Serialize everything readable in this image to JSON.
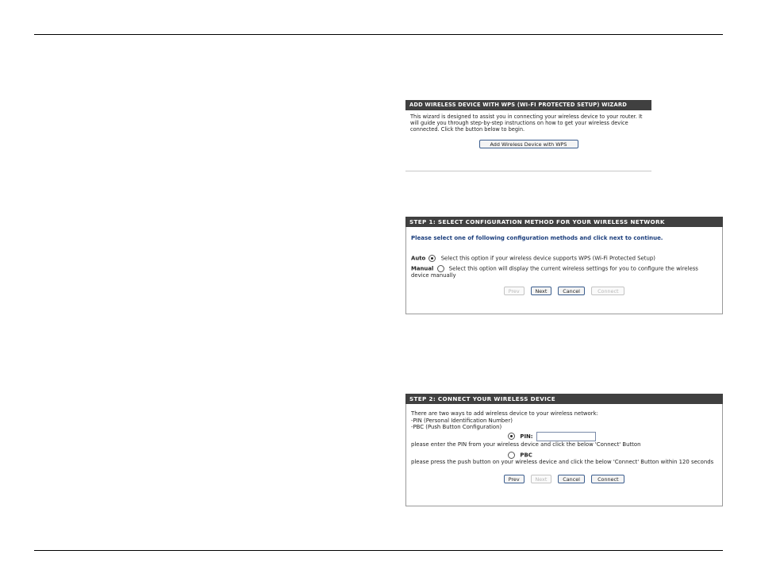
{
  "wizard_panel": {
    "title": "ADD WIRELESS DEVICE WITH WPS (WI-FI PROTECTED SETUP) WIZARD",
    "description": "This wizard is designed to assist you in connecting your wireless device to your router. It will guide you through step-by-step instructions on how to get your wireless device connected. Click the button below to begin.",
    "button_label": "Add Wireless Device with WPS"
  },
  "step1_panel": {
    "title": "STEP 1: SELECT CONFIGURATION METHOD FOR YOUR WIRELESS NETWORK",
    "instruction": "Please select one of following configuration methods and click next to continue.",
    "auto_label": "Auto",
    "auto_text": "Select this option if your wireless device supports WPS (Wi-Fi Protected Setup)",
    "auto_selected": true,
    "manual_label": "Manual",
    "manual_text": "Select this option will display the current wireless settings for you to configure the wireless device manually",
    "manual_selected": false,
    "buttons": {
      "prev": "Prev",
      "next": "Next",
      "cancel": "Cancel",
      "connect": "Connect"
    }
  },
  "step2_panel": {
    "title": "STEP 2: CONNECT YOUR WIRELESS DEVICE",
    "line1": "There are two ways to add wireless device to your wireless network:",
    "line2": "-PIN (Personal Identification Number)",
    "line3": "-PBC (Push Button Configuration)",
    "pin_label": "PIN:",
    "pin_value": "",
    "pin_selected": true,
    "pin_instruction": "please enter the PIN from your wireless device and click the below 'Connect' Button",
    "pbc_label": "PBC",
    "pbc_selected": false,
    "pbc_instruction": "please press the push button on your wireless device and click the below 'Connect' Button within 120 seconds",
    "buttons": {
      "prev": "Prev",
      "next": "Next",
      "cancel": "Cancel",
      "connect": "Connect"
    }
  }
}
